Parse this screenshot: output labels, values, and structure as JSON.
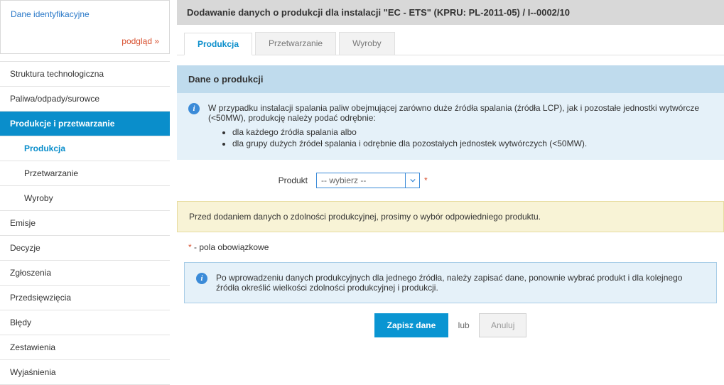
{
  "sidebar": {
    "boxTitle": "Dane identyfikacyjne",
    "previewLabel": "podgląd »",
    "nav": [
      "Struktura technologiczna",
      "Paliwa/odpady/surowce",
      "Produkcje i przetwarzanie",
      "Produkcja",
      "Przetwarzanie",
      "Wyroby",
      "Emisje",
      "Decyzje",
      "Zgłoszenia",
      "Przedsięwzięcia",
      "Błędy",
      "Zestawienia",
      "Wyjaśnienia"
    ]
  },
  "header": {
    "title": "Dodawanie danych o produkcji dla instalacji \"EC - ETS\" (KPRU: PL-2011-05) / I--0002/10"
  },
  "tabs": {
    "produkcja": "Produkcja",
    "przetwarzanie": "Przetwarzanie",
    "wyroby": "Wyroby"
  },
  "section": {
    "heading": "Dane o produkcji"
  },
  "info1": {
    "lead": "W przypadku instalacji spalania paliw obejmującej zarówno duże źródła spalania (źródła LCP), jak i pozostałe jednostki wytwórcze (<50MW), produkcję należy podać odrębnie:",
    "li1": "dla każdego źródła spalania albo",
    "li2": "dla grupy dużych źródeł spalania i odrębnie dla pozostałych jednostek wytwórczych (<50MW)."
  },
  "form": {
    "productLabel": "Produkt",
    "productPlaceholder": "-- wybierz --",
    "requiredMark": "*"
  },
  "warn": {
    "text": "Przed dodaniem danych o zdolności produkcyjnej, prosimy o wybór odpowiedniego produktu."
  },
  "reqNote": {
    "mark": "*",
    "text": " - pola obowiązkowe"
  },
  "info2": {
    "text": "Po wprowadzeniu danych produkcyjnych dla jednego źródła, należy zapisać dane, ponownie wybrać produkt i dla kolejnego źródła określić wielkości zdolności produkcyjnej i produkcji."
  },
  "actions": {
    "save": "Zapisz dane",
    "or": "lub",
    "cancel": "Anuluj"
  }
}
